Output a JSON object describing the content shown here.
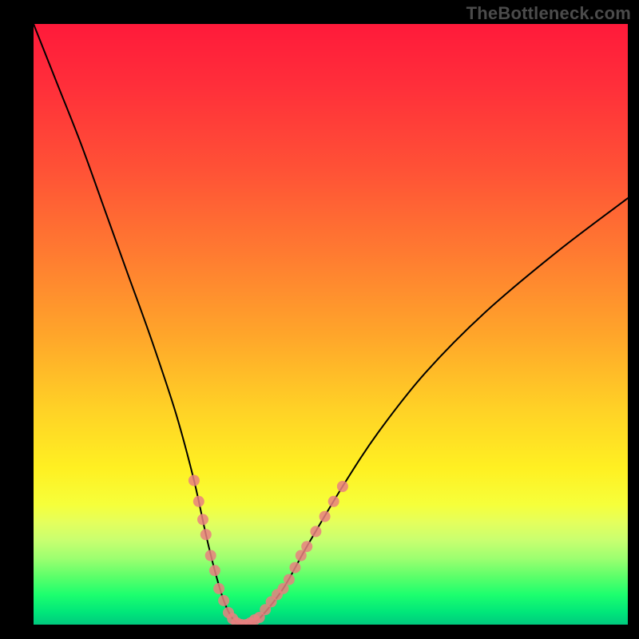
{
  "watermark": "TheBottleneck.com",
  "colors": {
    "background": "#000000",
    "gradient_top": "#ff1a3a",
    "gradient_mid": "#ffd126",
    "gradient_bottom": "#00c97e",
    "curve": "#000000",
    "markers": "#e98080"
  },
  "chart_data": {
    "type": "line",
    "title": "",
    "xlabel": "",
    "ylabel": "",
    "xlim": [
      0,
      100
    ],
    "ylim": [
      0,
      100
    ],
    "grid": false,
    "legend": false,
    "annotations": [],
    "series": [
      {
        "name": "curve",
        "x": [
          0,
          4,
          8,
          12,
          16,
          20,
          24,
          27,
          29,
          30.5,
          32,
          33.5,
          35,
          36.5,
          38,
          42,
          46,
          52,
          58,
          66,
          76,
          88,
          100
        ],
        "y": [
          100,
          90,
          80,
          69,
          58,
          47,
          35,
          24,
          15,
          9,
          4,
          1,
          0,
          0.3,
          1,
          6,
          13,
          23,
          32,
          42,
          52,
          62,
          71
        ]
      }
    ],
    "markers": [
      {
        "x": 27.0,
        "y": 24.0
      },
      {
        "x": 27.8,
        "y": 20.5
      },
      {
        "x": 28.5,
        "y": 17.5
      },
      {
        "x": 29.0,
        "y": 15.0
      },
      {
        "x": 29.8,
        "y": 11.5
      },
      {
        "x": 30.5,
        "y": 9.0
      },
      {
        "x": 31.2,
        "y": 6.0
      },
      {
        "x": 32.0,
        "y": 4.0
      },
      {
        "x": 32.8,
        "y": 2.0
      },
      {
        "x": 33.5,
        "y": 1.0
      },
      {
        "x": 34.2,
        "y": 0.3
      },
      {
        "x": 35.0,
        "y": 0.0
      },
      {
        "x": 35.8,
        "y": 0.0
      },
      {
        "x": 36.5,
        "y": 0.3
      },
      {
        "x": 37.2,
        "y": 0.8
      },
      {
        "x": 38.0,
        "y": 1.2
      },
      {
        "x": 39.0,
        "y": 2.5
      },
      {
        "x": 40.0,
        "y": 3.8
      },
      {
        "x": 41.0,
        "y": 5.0
      },
      {
        "x": 42.0,
        "y": 6.0
      },
      {
        "x": 43.0,
        "y": 7.5
      },
      {
        "x": 44.0,
        "y": 9.5
      },
      {
        "x": 45.0,
        "y": 11.5
      },
      {
        "x": 46.0,
        "y": 13.0
      },
      {
        "x": 47.5,
        "y": 15.5
      },
      {
        "x": 49.0,
        "y": 18.0
      },
      {
        "x": 50.5,
        "y": 20.5
      },
      {
        "x": 52.0,
        "y": 23.0
      }
    ],
    "minimum_x": 35.5
  }
}
